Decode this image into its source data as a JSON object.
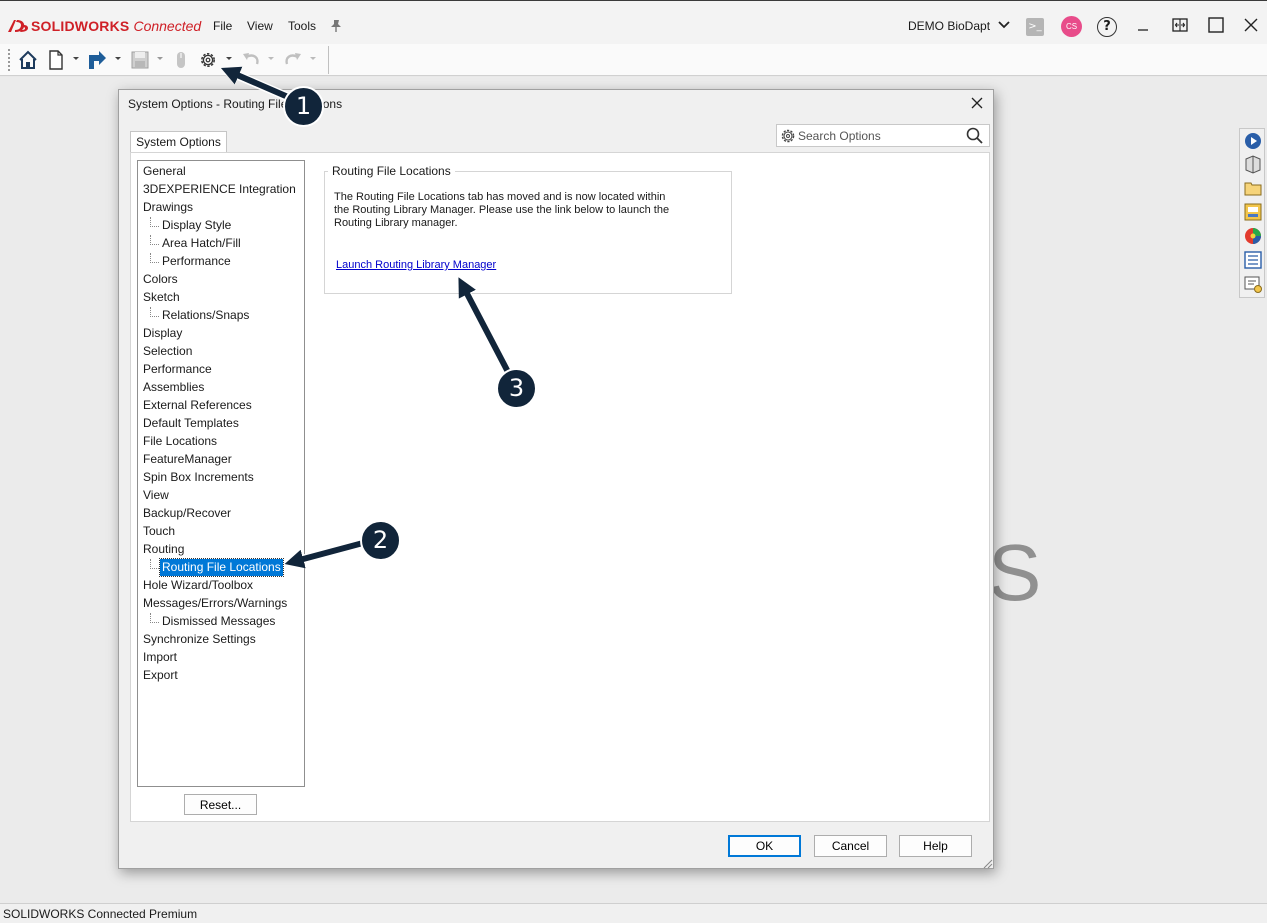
{
  "app": {
    "brand_main": "SOLIDWORKS",
    "brand_sub": "Connected",
    "menus": [
      "File",
      "View",
      "Tools"
    ],
    "user_name": "DEMO BioDapt",
    "avatar_initials": "CS",
    "help_glyph": "?",
    "accent_color": "#cf2027"
  },
  "dialog": {
    "title": "System Options - Routing File Locations",
    "tab_label": "System Options",
    "search_placeholder": "Search Options",
    "tree": [
      {
        "label": "General",
        "level": 0
      },
      {
        "label": "3DEXPERIENCE Integration",
        "level": 0
      },
      {
        "label": "Drawings",
        "level": 0
      },
      {
        "label": "Display Style",
        "level": 1
      },
      {
        "label": "Area Hatch/Fill",
        "level": 1
      },
      {
        "label": "Performance",
        "level": 1
      },
      {
        "label": "Colors",
        "level": 0
      },
      {
        "label": "Sketch",
        "level": 0
      },
      {
        "label": "Relations/Snaps",
        "level": 1
      },
      {
        "label": "Display",
        "level": 0
      },
      {
        "label": "Selection",
        "level": 0
      },
      {
        "label": "Performance",
        "level": 0
      },
      {
        "label": "Assemblies",
        "level": 0
      },
      {
        "label": "External References",
        "level": 0
      },
      {
        "label": "Default Templates",
        "level": 0
      },
      {
        "label": "File Locations",
        "level": 0
      },
      {
        "label": "FeatureManager",
        "level": 0
      },
      {
        "label": "Spin Box Increments",
        "level": 0
      },
      {
        "label": "View",
        "level": 0
      },
      {
        "label": "Backup/Recover",
        "level": 0
      },
      {
        "label": "Touch",
        "level": 0
      },
      {
        "label": "Routing",
        "level": 0
      },
      {
        "label": "Routing File Locations",
        "level": 1,
        "selected": true
      },
      {
        "label": "Hole Wizard/Toolbox",
        "level": 0
      },
      {
        "label": "Messages/Errors/Warnings",
        "level": 0
      },
      {
        "label": "Dismissed Messages",
        "level": 1
      },
      {
        "label": "Synchronize Settings",
        "level": 0
      },
      {
        "label": "Import",
        "level": 0
      },
      {
        "label": "Export",
        "level": 0
      }
    ],
    "reset_label": "Reset...",
    "group_title": "Routing File Locations",
    "group_text_lines": [
      "The Routing File Locations tab has moved and is now located within",
      "the Routing Library Manager. Please use the link below to launch the",
      "Routing Library manager."
    ],
    "link_label": "Launch Routing Library Manager",
    "ok_label": "OK",
    "cancel_label": "Cancel",
    "help_label": "Help",
    "selection_color": "#0078d7"
  },
  "annotations": [
    {
      "number": "1"
    },
    {
      "number": "2"
    },
    {
      "number": "3"
    }
  ],
  "status": {
    "text": "SOLIDWORKS Connected Premium"
  }
}
